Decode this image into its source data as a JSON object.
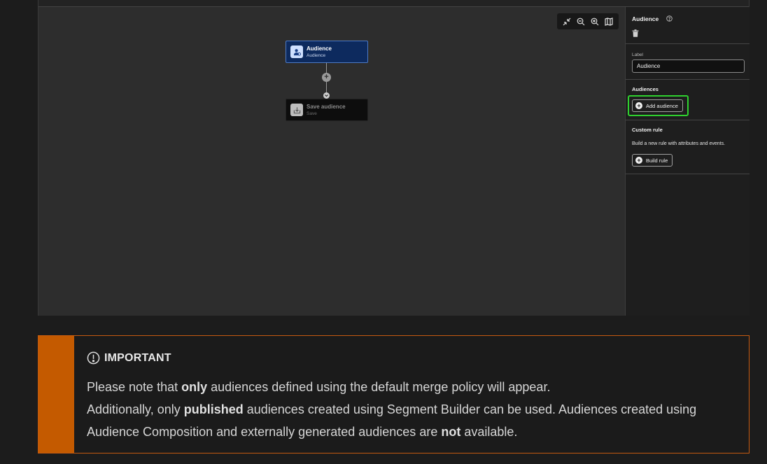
{
  "toolbar": {
    "icons": [
      "collapse-icon",
      "zoom-out-icon",
      "zoom-in-icon",
      "map-icon"
    ]
  },
  "nodes": {
    "audience": {
      "title": "Audience",
      "subtitle": "Audience"
    },
    "save": {
      "title": "Save audience",
      "subtitle": "Save"
    }
  },
  "panel": {
    "title": "Audience",
    "label_caption": "Label",
    "label_value": "Audience",
    "audiences_heading": "Audiences",
    "add_audience_label": "Add audience",
    "custom_rule_heading": "Custom rule",
    "custom_rule_desc": "Build a new rule with attributes and events.",
    "build_rule_label": "Build rule"
  },
  "colors": {
    "highlight": "#2fd12f",
    "node_selected": "#0d2a5e",
    "note_accent": "#c45a00"
  },
  "note": {
    "title": "IMPORTANT",
    "line1_pre": "Please note that ",
    "line1_bold": "only",
    "line1_post": " audiences defined using the default merge policy will appear.",
    "line2_pre": "Additionally, only ",
    "line2_bold": "published",
    "line2_post": " audiences created using Segment Builder can be used. Audiences created using",
    "line3_pre": "Audience Composition and externally generated audiences are ",
    "line3_bold": "not",
    "line3_post": " available."
  }
}
